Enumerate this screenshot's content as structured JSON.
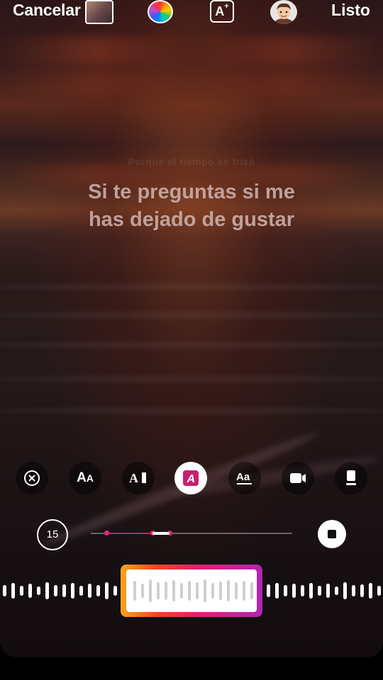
{
  "topbar": {
    "cancel_label": "Cancelar",
    "done_label": "Listo",
    "thumbnail_icon": "story-thumbnail",
    "color_icon": "color-wheel-icon",
    "effects_icon": "ai-text-icon",
    "avatar_icon": "avatar-sticker-icon"
  },
  "lyrics": {
    "previous_line": "Porque el tiempo se frizó",
    "current_line": "Si te preguntas si me has dejado de gustar",
    "color": "#c9aaa6"
  },
  "tools": [
    {
      "name": "remove-icon",
      "selected": false
    },
    {
      "name": "text-size-icon",
      "selected": false
    },
    {
      "name": "text-align-icon",
      "selected": false
    },
    {
      "name": "text-style-icon",
      "selected": true
    },
    {
      "name": "font-style-icon",
      "selected": false
    },
    {
      "name": "video-icon",
      "selected": false
    },
    {
      "name": "device-icon",
      "selected": false
    }
  ],
  "timeline": {
    "duration_label": "15",
    "accent_color": "#e0287a"
  },
  "waveform": {
    "frame_gradient": [
      "#f8a51b",
      "#f0481e",
      "#e0206f",
      "#b026b4"
    ]
  }
}
